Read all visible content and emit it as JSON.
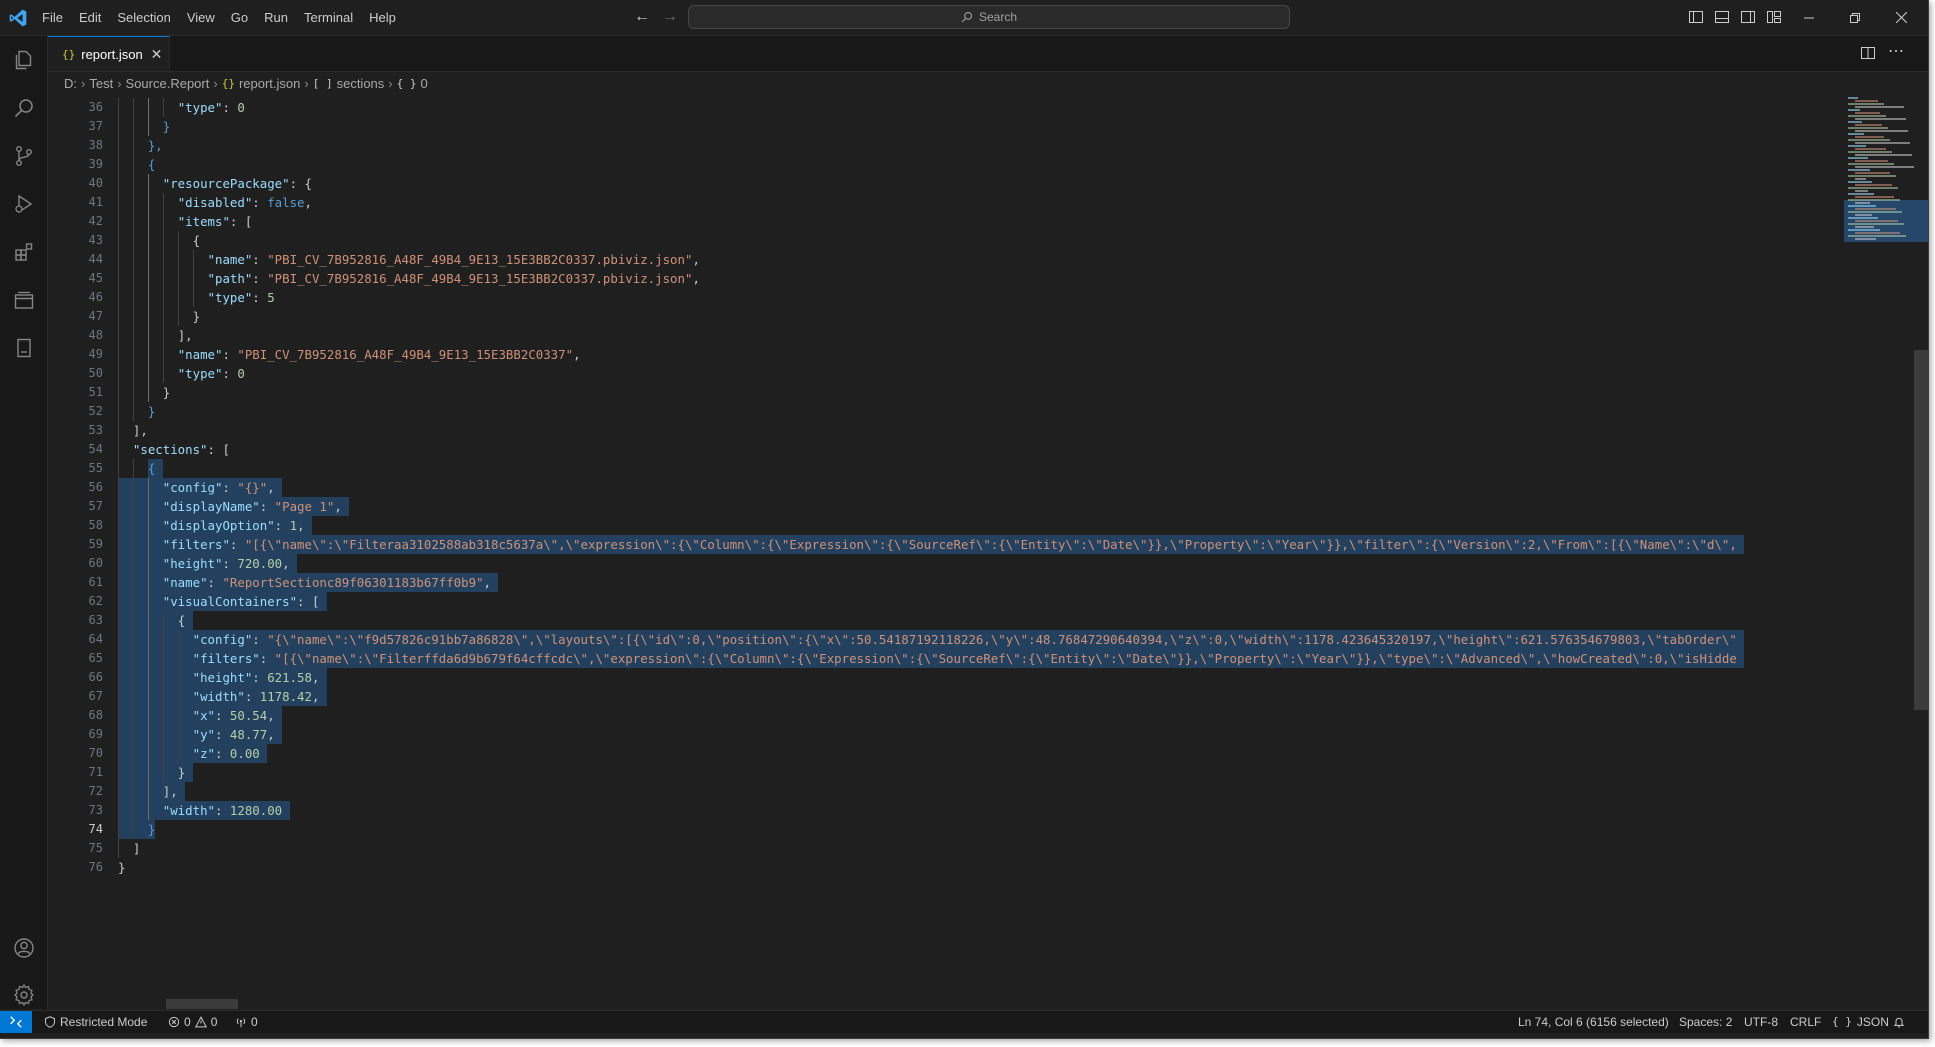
{
  "titlebar": {
    "menu": [
      "File",
      "Edit",
      "Selection",
      "View",
      "Go",
      "Run",
      "Terminal",
      "Help"
    ],
    "search_placeholder": "Search"
  },
  "activity_bar": {
    "icons": [
      "explorer-icon",
      "search-icon",
      "source-control-icon",
      "run-debug-icon",
      "extensions-icon",
      "remote-explorer-icon",
      "book-icon",
      "accounts-icon",
      "manage-gear-icon"
    ]
  },
  "tabs": [
    {
      "label": "report.json",
      "active": true
    }
  ],
  "breadcrumb": {
    "drive": "D:",
    "folder1": "Test",
    "folder2": "Source.Report",
    "file": "report.json",
    "sym1_icon": "[ ]",
    "sym1": "sections",
    "sym2_icon": "{ }",
    "sym2": "0"
  },
  "editor": {
    "first_line": 36,
    "active_line": 74,
    "lines": [
      [
        [
          "p",
          "        "
        ],
        [
          "k",
          "\"type\""
        ],
        [
          "p",
          ": "
        ],
        [
          "n",
          "0"
        ]
      ],
      [
        [
          "p",
          "      "
        ],
        [
          "b",
          "}"
        ]
      ],
      [
        [
          "p",
          "    "
        ],
        [
          "b",
          "},"
        ]
      ],
      [
        [
          "p",
          "    "
        ],
        [
          "b",
          "{"
        ]
      ],
      [
        [
          "p",
          "      "
        ],
        [
          "k",
          "\"resourcePackage\""
        ],
        [
          "p",
          ": {"
        ]
      ],
      [
        [
          "p",
          "        "
        ],
        [
          "k",
          "\"disabled\""
        ],
        [
          "p",
          ": "
        ],
        [
          "b",
          "false"
        ],
        [
          "p",
          ","
        ]
      ],
      [
        [
          "p",
          "        "
        ],
        [
          "k",
          "\"items\""
        ],
        [
          "p",
          ": ["
        ]
      ],
      [
        [
          "p",
          "          "
        ],
        [
          "p",
          "{"
        ]
      ],
      [
        [
          "p",
          "            "
        ],
        [
          "k",
          "\"name\""
        ],
        [
          "p",
          ": "
        ],
        [
          "s",
          "\"PBI_CV_7B952816_A48F_49B4_9E13_15E3BB2C0337.pbiviz.json\""
        ],
        [
          "p",
          ","
        ]
      ],
      [
        [
          "p",
          "            "
        ],
        [
          "k",
          "\"path\""
        ],
        [
          "p",
          ": "
        ],
        [
          "s",
          "\"PBI_CV_7B952816_A48F_49B4_9E13_15E3BB2C0337.pbiviz.json\""
        ],
        [
          "p",
          ","
        ]
      ],
      [
        [
          "p",
          "            "
        ],
        [
          "k",
          "\"type\""
        ],
        [
          "p",
          ": "
        ],
        [
          "n",
          "5"
        ]
      ],
      [
        [
          "p",
          "          "
        ],
        [
          "p",
          "}"
        ]
      ],
      [
        [
          "p",
          "        "
        ],
        [
          "p",
          "],"
        ]
      ],
      [
        [
          "p",
          "        "
        ],
        [
          "k",
          "\"name\""
        ],
        [
          "p",
          ": "
        ],
        [
          "s",
          "\"PBI_CV_7B952816_A48F_49B4_9E13_15E3BB2C0337\""
        ],
        [
          "p",
          ","
        ]
      ],
      [
        [
          "p",
          "        "
        ],
        [
          "k",
          "\"type\""
        ],
        [
          "p",
          ": "
        ],
        [
          "n",
          "0"
        ]
      ],
      [
        [
          "p",
          "      "
        ],
        [
          "p",
          "}"
        ]
      ],
      [
        [
          "p",
          "    "
        ],
        [
          "b",
          "}"
        ]
      ],
      [
        [
          "p",
          "  "
        ],
        [
          "p",
          "],"
        ]
      ],
      [
        [
          "p",
          "  "
        ],
        [
          "k",
          "\"sections\""
        ],
        [
          "p",
          ": ["
        ]
      ],
      [
        [
          "p",
          "    "
        ],
        [
          "b",
          "{"
        ]
      ],
      [
        [
          "p",
          "      "
        ],
        [
          "k",
          "\"config\""
        ],
        [
          "p",
          ": "
        ],
        [
          "s",
          "\"{}\""
        ],
        [
          "p",
          ","
        ]
      ],
      [
        [
          "p",
          "      "
        ],
        [
          "k",
          "\"displayName\""
        ],
        [
          "p",
          ": "
        ],
        [
          "s",
          "\"Page 1\""
        ],
        [
          "p",
          ","
        ]
      ],
      [
        [
          "p",
          "      "
        ],
        [
          "k",
          "\"displayOption\""
        ],
        [
          "p",
          ": "
        ],
        [
          "n",
          "1"
        ],
        [
          "p",
          ","
        ]
      ],
      [
        [
          "p",
          "      "
        ],
        [
          "k",
          "\"filters\""
        ],
        [
          "p",
          ": "
        ],
        [
          "s",
          "\"[{\\\"name\\\":\\\"Filteraa3102588ab318c5637a\\\",\\\"expression\\\":{\\\"Column\\\":{\\\"Expression\\\":{\\\"SourceRef\\\":{\\\"Entity\\\":\\\"Date\\\"}},\\\"Property\\\":\\\"Year\\\"}},\\\"filter\\\":{\\\"Version\\\":2,\\\"From\\\":[{\\\"Name\\\":\\\"d\\\","
        ]
      ],
      [
        [
          "p",
          "      "
        ],
        [
          "k",
          "\"height\""
        ],
        [
          "p",
          ": "
        ],
        [
          "n",
          "720.00"
        ],
        [
          "p",
          ","
        ]
      ],
      [
        [
          "p",
          "      "
        ],
        [
          "k",
          "\"name\""
        ],
        [
          "p",
          ": "
        ],
        [
          "s",
          "\"ReportSectionc89f06301183b67ff0b9\""
        ],
        [
          "p",
          ","
        ]
      ],
      [
        [
          "p",
          "      "
        ],
        [
          "k",
          "\"visualContainers\""
        ],
        [
          "p",
          ": ["
        ]
      ],
      [
        [
          "p",
          "        "
        ],
        [
          "p",
          "{"
        ]
      ],
      [
        [
          "p",
          "          "
        ],
        [
          "k",
          "\"config\""
        ],
        [
          "p",
          ": "
        ],
        [
          "s",
          "\"{\\\"name\\\":\\\"f9d57826c91bb7a86828\\\",\\\"layouts\\\":[{\\\"id\\\":0,\\\"position\\\":{\\\"x\\\":50.54187192118226,\\\"y\\\":48.76847290640394,\\\"z\\\":0,\\\"width\\\":1178.423645320197,\\\"height\\\":621.576354679803,\\\"tabOrder\\\""
        ]
      ],
      [
        [
          "p",
          "          "
        ],
        [
          "k",
          "\"filters\""
        ],
        [
          "p",
          ": "
        ],
        [
          "s",
          "\"[{\\\"name\\\":\\\"Filterffda6d9b679f64cffcdc\\\",\\\"expression\\\":{\\\"Column\\\":{\\\"Expression\\\":{\\\"SourceRef\\\":{\\\"Entity\\\":\\\"Date\\\"}},\\\"Property\\\":\\\"Year\\\"}},\\\"type\\\":\\\"Advanced\\\",\\\"howCreated\\\":0,\\\"isHidde"
        ]
      ],
      [
        [
          "p",
          "          "
        ],
        [
          "k",
          "\"height\""
        ],
        [
          "p",
          ": "
        ],
        [
          "n",
          "621.58"
        ],
        [
          "p",
          ","
        ]
      ],
      [
        [
          "p",
          "          "
        ],
        [
          "k",
          "\"width\""
        ],
        [
          "p",
          ": "
        ],
        [
          "n",
          "1178.42"
        ],
        [
          "p",
          ","
        ]
      ],
      [
        [
          "p",
          "          "
        ],
        [
          "k",
          "\"x\""
        ],
        [
          "p",
          ": "
        ],
        [
          "n",
          "50.54"
        ],
        [
          "p",
          ","
        ]
      ],
      [
        [
          "p",
          "          "
        ],
        [
          "k",
          "\"y\""
        ],
        [
          "p",
          ": "
        ],
        [
          "n",
          "48.77"
        ],
        [
          "p",
          ","
        ]
      ],
      [
        [
          "p",
          "          "
        ],
        [
          "k",
          "\"z\""
        ],
        [
          "p",
          ": "
        ],
        [
          "n",
          "0.00"
        ]
      ],
      [
        [
          "p",
          "        "
        ],
        [
          "p",
          "}"
        ]
      ],
      [
        [
          "p",
          "      "
        ],
        [
          "p",
          "],"
        ]
      ],
      [
        [
          "p",
          "      "
        ],
        [
          "k",
          "\"width\""
        ],
        [
          "p",
          ": "
        ],
        [
          "n",
          "1280.00"
        ]
      ],
      [
        [
          "p",
          "    "
        ],
        [
          "b",
          "}"
        ]
      ],
      [
        [
          "p",
          "  "
        ],
        [
          "p",
          "]"
        ]
      ],
      [
        [
          "p",
          ""
        ],
        [
          "p",
          "}"
        ]
      ]
    ]
  },
  "statusbar": {
    "restricted": "Restricted Mode",
    "errors": "0",
    "warnings": "0",
    "ports": "0",
    "position": "Ln 74, Col 6 (6156 selected)",
    "spaces": "Spaces: 2",
    "encoding": "UTF-8",
    "eol": "CRLF",
    "language_icon": "{ }",
    "language": "JSON"
  },
  "colors": {
    "accent": "#0078d4",
    "key": "#9cdcfe",
    "string": "#ce9178",
    "number": "#b5cea8",
    "keyword": "#569cd6",
    "selection": "#264f78"
  }
}
